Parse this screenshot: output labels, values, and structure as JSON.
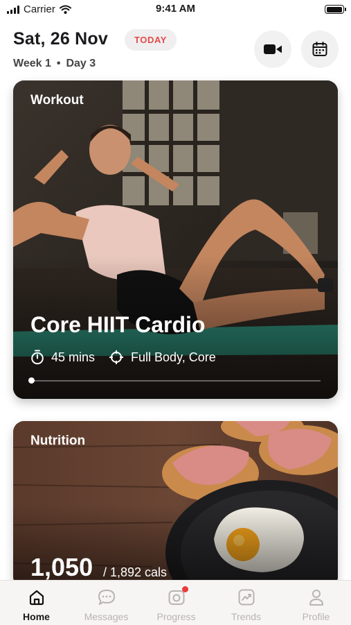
{
  "status_bar": {
    "carrier": "Carrier",
    "time": "9:41 AM"
  },
  "header": {
    "date": "Sat, 26 Nov",
    "today_badge": "TODAY",
    "week": "Week 1",
    "separator": "•",
    "day": "Day 3",
    "icons": [
      "video-camera-icon",
      "calendar-icon"
    ]
  },
  "workout_card": {
    "label": "Workout",
    "title": "Core HIIT Cardio",
    "duration": "45 mins",
    "focus": "Full Body, Core",
    "progress": 0.0
  },
  "nutrition_card": {
    "label": "Nutrition",
    "calories": "1,050",
    "goal": "/ 1,892 cals"
  },
  "tabs": [
    {
      "label": "Home",
      "icon": "home-icon",
      "active": true
    },
    {
      "label": "Messages",
      "icon": "chat-icon",
      "active": false
    },
    {
      "label": "Progress",
      "icon": "camera-icon",
      "active": false,
      "badge": true
    },
    {
      "label": "Trends",
      "icon": "trend-icon",
      "active": false
    },
    {
      "label": "Profile",
      "icon": "person-icon",
      "active": false
    }
  ],
  "colors": {
    "accent": "#e24a4a",
    "badge": "#ea3b3b",
    "inactive_tab": "#b7b4b0"
  }
}
